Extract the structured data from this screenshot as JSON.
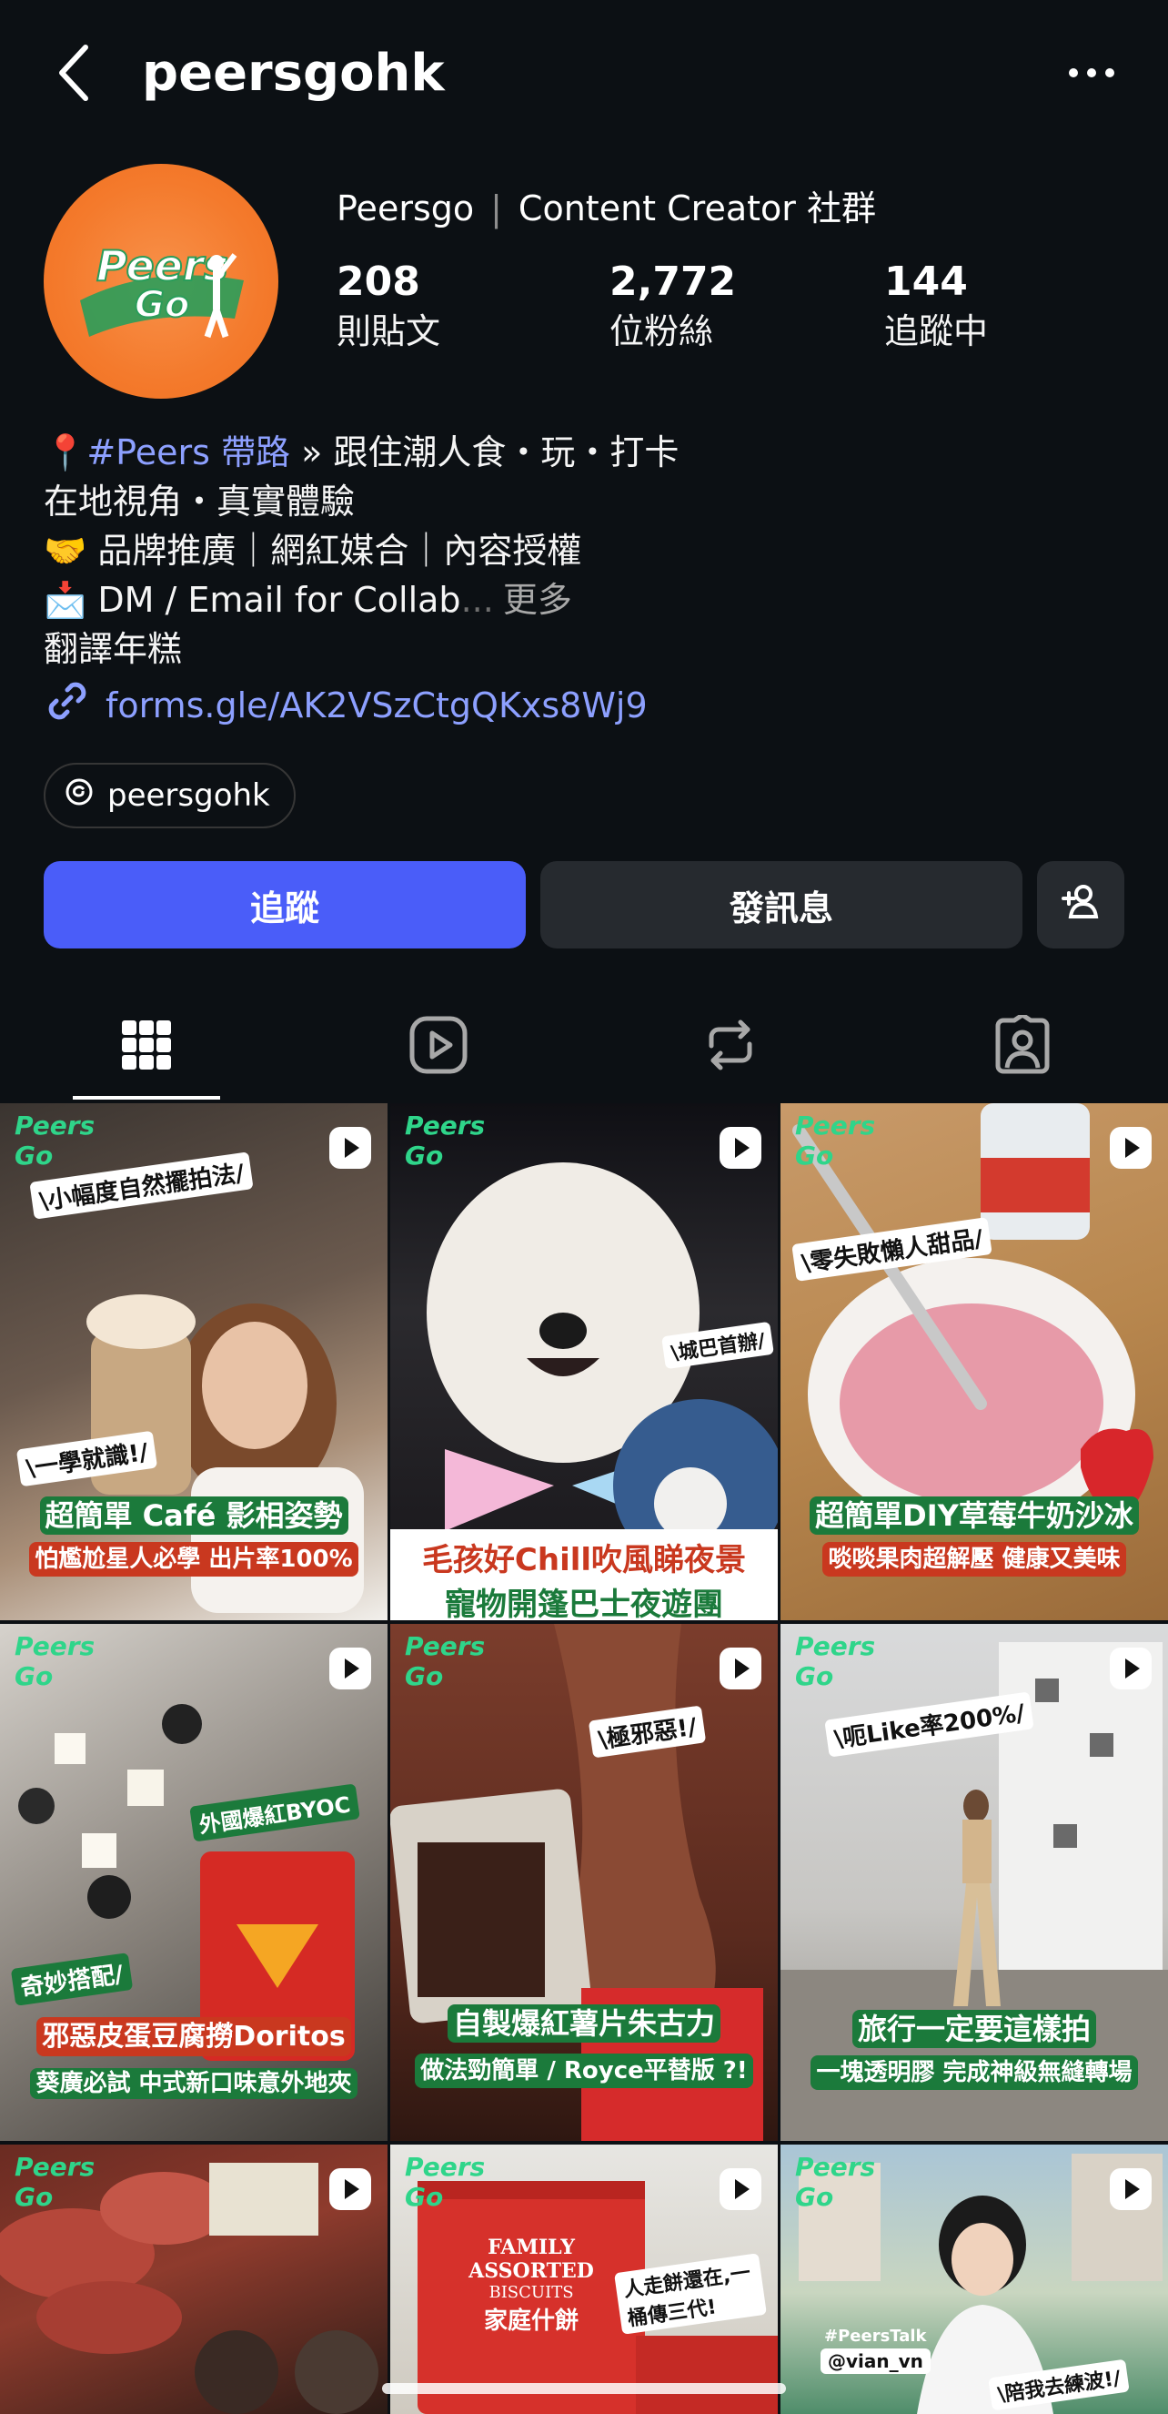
{
  "header": {
    "username": "peersgohk"
  },
  "profile": {
    "display_name": "Peersgo",
    "category": "Content Creator 社群",
    "stats": [
      {
        "value": "208",
        "label": "則貼文"
      },
      {
        "value": "2,772",
        "label": "位粉絲"
      },
      {
        "value": "144",
        "label": "追蹤中"
      }
    ]
  },
  "bio": {
    "line1_tag": "#Peers 帶路",
    "line1_rest": " » 跟住潮人食・玩・打卡",
    "line2": " 在地視角・真實體驗",
    "line3": " 品牌推廣｜網紅媒合｜內容授權",
    "line4": " DM / Email for Collab",
    "line4_ellipsis": "...",
    "more": "更多",
    "translate": "翻譯年糕",
    "link": "forms.gle/AK2VSzCtgQKxs8Wj9"
  },
  "threads": {
    "label": "peersgohk"
  },
  "actions": {
    "follow": "追蹤",
    "message": "發訊息"
  },
  "posts": [
    {
      "tag": "\\小幅度自然擺拍法/",
      "tag2": "\\一學就識!/",
      "main": "超簡單 Café 影相姿勢",
      "sub": "怕尷尬星人必學 出片率100%"
    },
    {
      "tag": "\\城巴首辦/",
      "main": "毛孩好Chill吹風睇夜景",
      "sub": "寵物開篷巴士夜遊團"
    },
    {
      "tag": "\\零失敗懶人甜品/",
      "main": "超簡單DIY草莓牛奶沙冰",
      "sub": "啖啖果肉超解壓 健康又美味"
    },
    {
      "tag": "外國爆紅BYOC",
      "tag2": "奇妙搭配/",
      "main": "邪惡皮蛋豆腐撈Doritos",
      "sub": "葵廣必試 中式新口味意外地夾"
    },
    {
      "tag": "\\極邪惡!/",
      "main": "自製爆紅薯片朱古力",
      "sub": "做法勁簡單 / Royce平替版 ?!"
    },
    {
      "tag": "\\呃Like率200%/",
      "main": "旅行一定要這樣拍",
      "sub": "一塊透明膠 完成神級無縫轉場"
    },
    {
      "tag": ""
    },
    {
      "tag": "人走餅還在,一桶傳三代!",
      "tin1": "FAMILY ASSORTED",
      "tin2": "BISCUITS",
      "tin3": "家庭什餅"
    },
    {
      "tag": "\\陪我去練波!/",
      "tag2": "#PeersTalk",
      "tag3": "@vian_vn"
    }
  ],
  "logo_text": "Peers Go"
}
